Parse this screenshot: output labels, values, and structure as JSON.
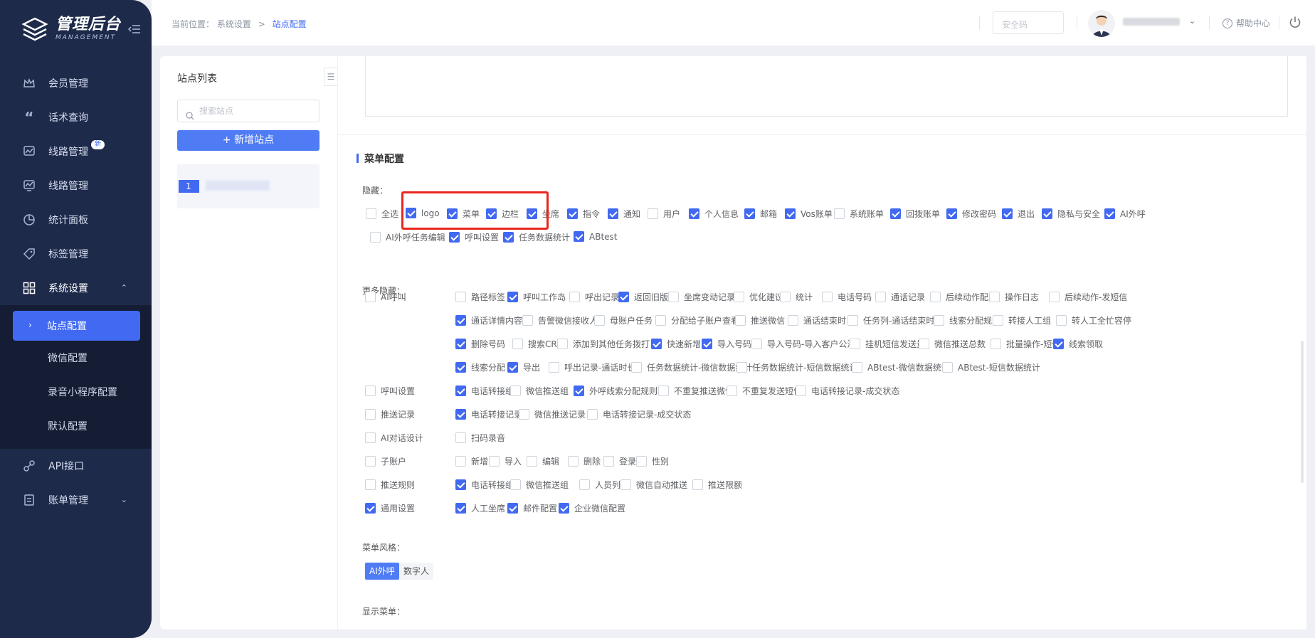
{
  "app": {
    "title": "管理后台",
    "subtitle": "MANAGEMENT"
  },
  "nav": {
    "items": [
      {
        "label": "会员管理",
        "icon": "crown-icon"
      },
      {
        "label": "话术查询",
        "icon": "quote-icon"
      },
      {
        "label": "线路管理",
        "icon": "route-icon",
        "badge": "新"
      },
      {
        "label": "线路管理",
        "icon": "monitor-icon"
      },
      {
        "label": "统计面板",
        "icon": "pie-icon"
      },
      {
        "label": "标签管理",
        "icon": "tag-icon"
      },
      {
        "label": "系统设置",
        "icon": "grid-icon"
      }
    ],
    "sub_items": [
      "站点配置",
      "微信配置",
      "录音小程序配置",
      "默认配置"
    ],
    "bottom_items": [
      {
        "label": "API接口",
        "icon": "link-icon"
      },
      {
        "label": "账单管理",
        "icon": "bill-icon"
      }
    ]
  },
  "header": {
    "breadcrumb_prefix": "当前位置：",
    "breadcrumb_parent": "系统设置",
    "breadcrumb_sep": ">",
    "breadcrumb_current": "站点配置",
    "safe_placeholder": "安全码",
    "help": "帮助中心"
  },
  "station": {
    "title": "站点列表",
    "search_placeholder": "搜索站点",
    "add_label": "+ 新增站点",
    "item_number": "1"
  },
  "menu_config": {
    "title": "菜单配置",
    "hide_label": "隐藏：",
    "hide_options": [
      {
        "label": "全选",
        "checked": false
      },
      {
        "label": "logo",
        "checked": true
      },
      {
        "label": "菜单",
        "checked": true
      },
      {
        "label": "边栏",
        "checked": true
      },
      {
        "label": "坐席",
        "checked": true
      },
      {
        "label": "指令",
        "checked": true
      },
      {
        "label": "通知",
        "checked": true
      },
      {
        "label": "用户",
        "checked": false
      },
      {
        "label": "个人信息",
        "checked": true
      },
      {
        "label": "邮箱",
        "checked": true
      },
      {
        "label": "Vos账单",
        "checked": true
      },
      {
        "label": "系统账单",
        "checked": false
      },
      {
        "label": "回拨账单",
        "checked": true
      },
      {
        "label": "修改密码",
        "checked": true
      },
      {
        "label": "退出",
        "checked": true
      },
      {
        "label": "隐私与安全",
        "checked": true
      },
      {
        "label": "AI外呼",
        "checked": true
      },
      {
        "label": "AI外呼任务编辑",
        "checked": false
      },
      {
        "label": "呼叫设置",
        "checked": true
      },
      {
        "label": "任务数据统计",
        "checked": true
      },
      {
        "label": "ABtest",
        "checked": true
      }
    ],
    "more_hide_label": "更多隐藏：",
    "more_groups": [
      {
        "label": "AI呼叫",
        "checked": false,
        "lines": [
          [
            {
              "label": "路径标签",
              "checked": false
            },
            {
              "label": "呼叫工作岛",
              "checked": true
            },
            {
              "label": "呼出记录",
              "checked": false
            },
            {
              "label": "返回旧版",
              "checked": true
            },
            {
              "label": "坐席变动记录",
              "checked": false
            },
            {
              "label": "优化建议",
              "checked": false
            },
            {
              "label": "统计",
              "checked": false
            },
            {
              "label": "电话号码",
              "checked": false
            },
            {
              "label": "通话记录",
              "checked": false
            },
            {
              "label": "后续动作配置",
              "checked": false
            },
            {
              "label": "操作日志",
              "checked": false
            },
            {
              "label": "后续动作-发短信",
              "checked": false
            }
          ],
          [
            {
              "label": "通话详情内容",
              "checked": true
            },
            {
              "label": "告警微信接收人",
              "checked": false
            },
            {
              "label": "母账户任务",
              "checked": false
            },
            {
              "label": "分配给子账户查看",
              "checked": false
            },
            {
              "label": "推送微信",
              "checked": false
            },
            {
              "label": "通话结束时",
              "checked": false
            },
            {
              "label": "任务列-通话结束时",
              "checked": false
            },
            {
              "label": "线索分配规则",
              "checked": false
            },
            {
              "label": "转接人工组",
              "checked": false
            },
            {
              "label": "转人工全忙容停",
              "checked": false
            }
          ],
          [
            {
              "label": "删除号码",
              "checked": true
            },
            {
              "label": "搜索CRM",
              "checked": false
            },
            {
              "label": "添加到其他任务拨打",
              "checked": false
            },
            {
              "label": "快速新增",
              "checked": true
            },
            {
              "label": "导入号码",
              "checked": true
            },
            {
              "label": "导入号码-导入客户公海",
              "checked": false
            },
            {
              "label": "挂机短信发送量",
              "checked": false
            },
            {
              "label": "微信推送总数",
              "checked": false
            },
            {
              "label": "批量操作-短信",
              "checked": false
            },
            {
              "label": "线索领取",
              "checked": true
            }
          ],
          [
            {
              "label": "线索分配",
              "checked": true
            },
            {
              "label": "导出",
              "checked": true
            },
            {
              "label": "呼出记录-通话时长",
              "checked": false
            },
            {
              "label": "任务数据统计-微信数据统计",
              "checked": false
            },
            {
              "label": "任务数据统计-短信数据统计",
              "checked": false
            },
            {
              "label": "ABtest-微信数据统计",
              "checked": false
            },
            {
              "label": "ABtest-短信数据统计",
              "checked": false
            }
          ]
        ]
      },
      {
        "label": "呼叫设置",
        "checked": false,
        "lines": [
          [
            {
              "label": "电话转接组",
              "checked": true
            },
            {
              "label": "微信推送组",
              "checked": false
            },
            {
              "label": "外呼线索分配规则",
              "checked": true
            },
            {
              "label": "不重复推送微信",
              "checked": false
            },
            {
              "label": "不重复发送短信",
              "checked": false
            },
            {
              "label": "电话转接记录-成交状态",
              "checked": false
            }
          ]
        ]
      },
      {
        "label": "推送记录",
        "checked": false,
        "lines": [
          [
            {
              "label": "电话转接记录",
              "checked": true
            },
            {
              "label": "微信推送记录",
              "checked": false
            },
            {
              "label": "电话转接记录-成交状态",
              "checked": false
            }
          ]
        ]
      },
      {
        "label": "AI对话设计",
        "checked": false,
        "lines": [
          [
            {
              "label": "扫码录音",
              "checked": false
            }
          ]
        ]
      },
      {
        "label": "子账户",
        "checked": false,
        "lines": [
          [
            {
              "label": "新增",
              "checked": false
            },
            {
              "label": "导入",
              "checked": false
            },
            {
              "label": "编辑",
              "checked": false
            },
            {
              "label": "删除",
              "checked": false
            },
            {
              "label": "登录",
              "checked": false
            },
            {
              "label": "性别",
              "checked": false
            }
          ]
        ]
      },
      {
        "label": "推送规则",
        "checked": false,
        "lines": [
          [
            {
              "label": "电话转接组",
              "checked": true
            },
            {
              "label": "微信推送组",
              "checked": false
            },
            {
              "label": "人员列表",
              "checked": false
            },
            {
              "label": "微信自动推送",
              "checked": false
            },
            {
              "label": "推送限额",
              "checked": false
            }
          ]
        ]
      },
      {
        "label": "通用设置",
        "checked": true,
        "lines": [
          [
            {
              "label": "人工坐席",
              "checked": true
            },
            {
              "label": "邮件配置",
              "checked": true
            },
            {
              "label": "企业微信配置",
              "checked": true
            }
          ]
        ]
      }
    ],
    "style_label": "菜单风格：",
    "style_options": [
      {
        "label": "AI外呼",
        "active": true
      },
      {
        "label": "数字人",
        "active": false
      }
    ],
    "show_menu_label": "显示菜单："
  },
  "colors": {
    "accent": "#4169f2",
    "sidebar": "#1d2a4a",
    "highlight": "#e8261f"
  }
}
